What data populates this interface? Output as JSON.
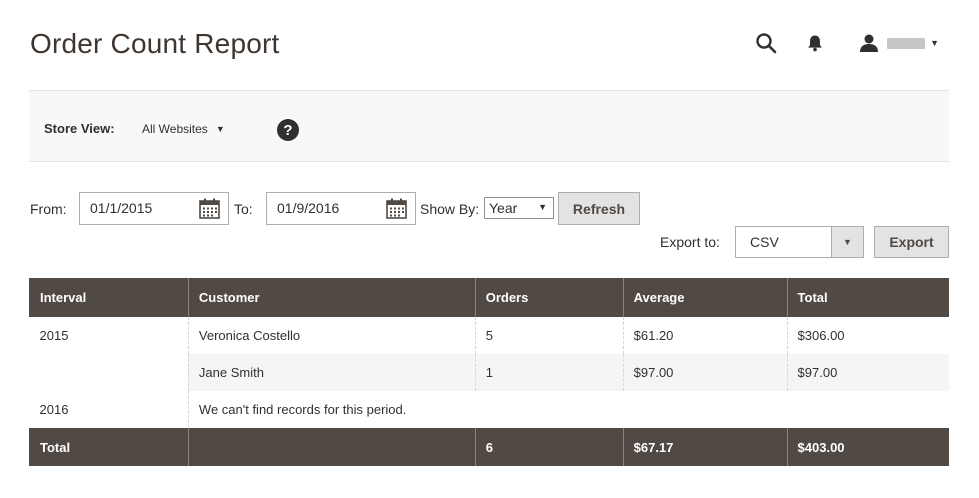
{
  "page": {
    "title": "Order Count Report"
  },
  "header": {
    "icons": [
      "search-icon",
      "bell-icon",
      "user-icon"
    ],
    "user_caret": "▼"
  },
  "store_view": {
    "label": "Store View:",
    "value": "All Websites",
    "caret": "▼",
    "help": "?"
  },
  "filter": {
    "from_label": "From:",
    "from_value": "01/1/2015",
    "to_label": "To:",
    "to_value": "01/9/2016",
    "show_by_label": "Show By:",
    "show_by_value": "Year",
    "caret": "▼",
    "refresh_label": "Refresh"
  },
  "export": {
    "label": "Export to:",
    "format": "CSV",
    "caret": "▼",
    "button_label": "Export"
  },
  "table": {
    "headers": [
      "Interval",
      "Customer",
      "Orders",
      "Average",
      "Total"
    ],
    "rows": [
      {
        "interval": "2015",
        "customer": "Veronica Costello",
        "orders": "5",
        "average": "$61.20",
        "total": "$306.00"
      },
      {
        "interval": "",
        "customer": "Jane Smith",
        "orders": "1",
        "average": "$97.00",
        "total": "$97.00"
      },
      {
        "interval": "2016",
        "message": "We can't find records for this period."
      }
    ],
    "footer": {
      "label": "Total",
      "customer": "",
      "orders": "6",
      "average": "$67.17",
      "total": "$403.00"
    }
  },
  "colors": {
    "header_dark": "#514943",
    "button_bg": "#e3e3e3",
    "store_bar_bg": "#f8f8f8",
    "title": "#41362f"
  }
}
